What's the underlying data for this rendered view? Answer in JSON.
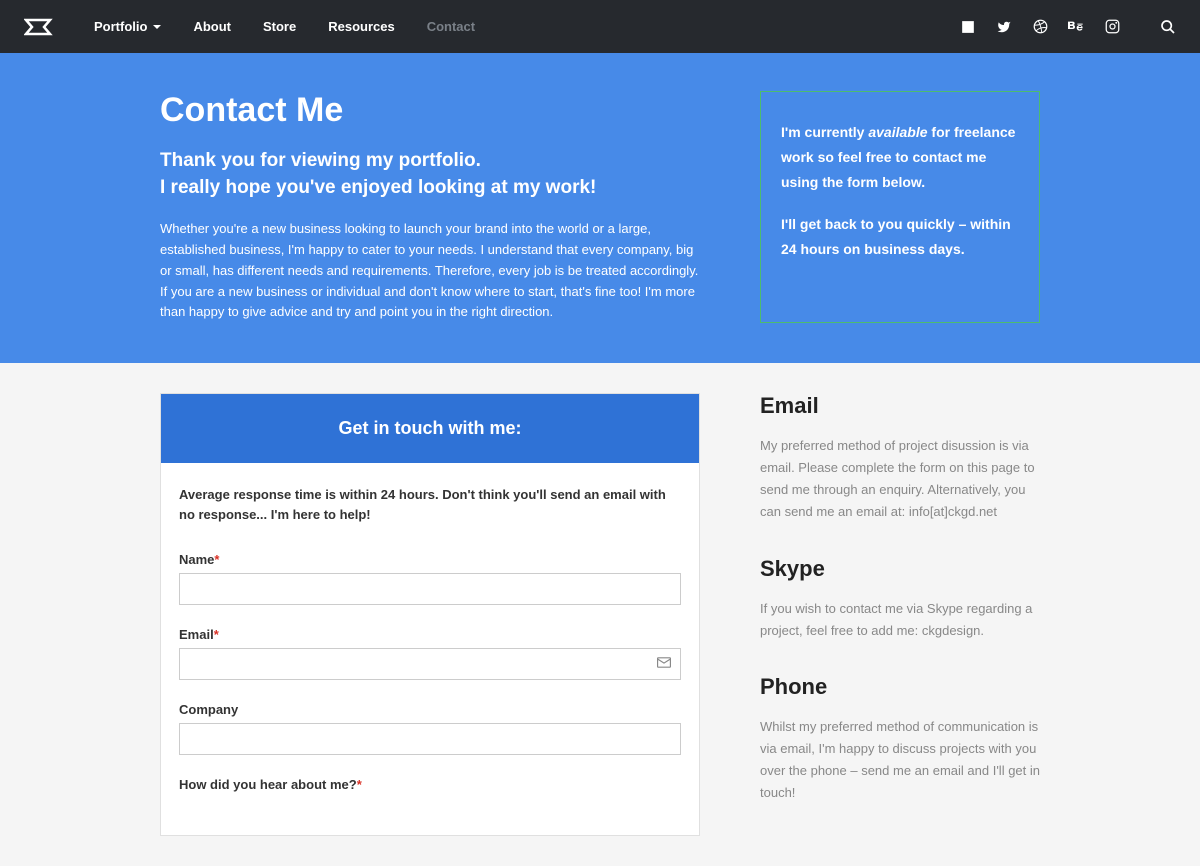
{
  "nav": {
    "items": [
      {
        "label": "Portfolio",
        "hasDropdown": true
      },
      {
        "label": "About"
      },
      {
        "label": "Store"
      },
      {
        "label": "Resources"
      },
      {
        "label": "Contact",
        "active": true
      }
    ]
  },
  "hero": {
    "title": "Contact Me",
    "subtitle1": "Thank you for viewing my portfolio.",
    "subtitle2": "I really hope you've enjoyed looking at my work!",
    "text": "Whether you're a new business looking to launch your brand into the world or a large, established business, I'm happy to cater to your needs. I understand that every company, big or small, has different needs and requirements. Therefore, every job is be treated accordingly. If you are a new business or individual and don't know where to start, that's fine too! I'm more than happy to give advice and try and point you in the right direction.",
    "box": {
      "p1_pre": "I'm currently ",
      "p1_em": "available",
      "p1_post": " for freelance work so feel free to contact me using the form below.",
      "p2": "I'll get back to you quickly – within 24 hours on business days."
    }
  },
  "form": {
    "header": "Get in touch with me:",
    "intro": "Average response time is within 24 hours. Don't think you'll send an email with no response... I'm here to help!",
    "fields": {
      "name": "Name",
      "email": "Email",
      "company": "Company",
      "howHeard": "How did you hear about me?"
    }
  },
  "sidebar": {
    "email": {
      "title": "Email",
      "text": "My preferred method of project disussion is via email. Please complete the form on this page to send me through an enquiry. Alternatively, you can send me an email at: info[at]ckgd.net"
    },
    "skype": {
      "title": "Skype",
      "text": "If you wish to contact me via Skype regarding a project, feel free to add me: ckgdesign."
    },
    "phone": {
      "title": "Phone",
      "text": "Whilst my preferred method of communication is via email, I'm happy to discuss projects with you over the phone – send me an email and I'll get in touch!"
    }
  }
}
